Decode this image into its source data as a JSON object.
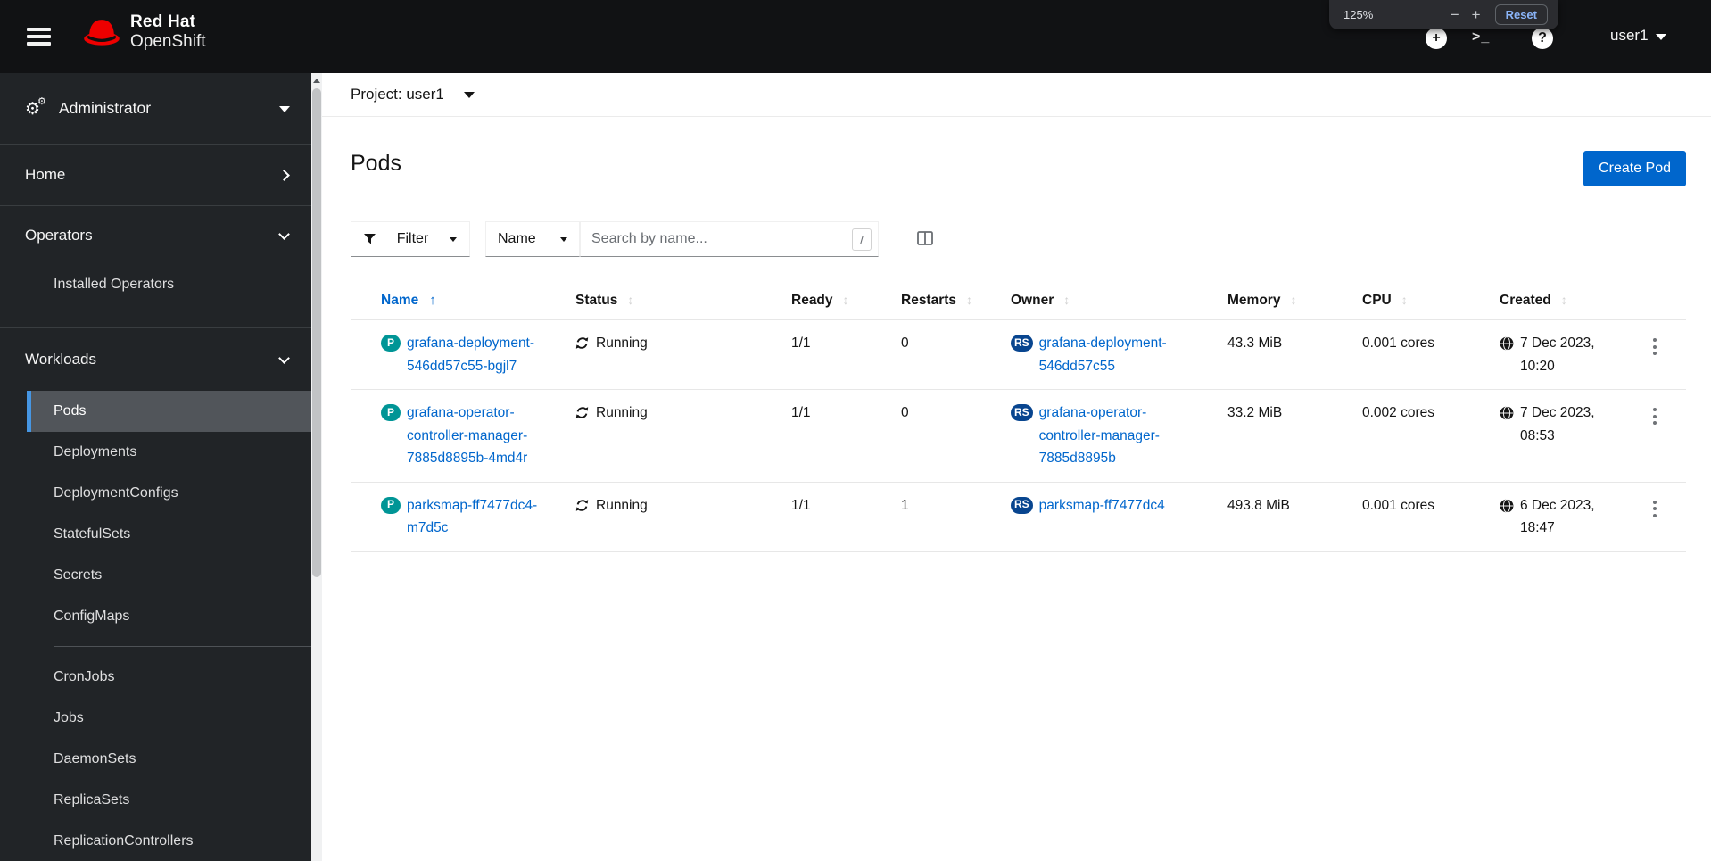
{
  "masthead": {
    "brand": {
      "line1": "Red Hat",
      "line2": "OpenShift"
    },
    "user_label": "user1",
    "plus_icon_glyph": "+",
    "help_icon_glyph": "?"
  },
  "browser_zoom_popup": {
    "zoom_level": "125%",
    "zoom_out_label": "−",
    "zoom_in_label": "+",
    "reset_label": "Reset"
  },
  "sidebar": {
    "perspective_label": "Administrator",
    "home_label": "Home",
    "operators_label": "Operators",
    "operators_items": [
      "Installed Operators"
    ],
    "workloads_label": "Workloads",
    "workloads_items": [
      "Pods",
      "Deployments",
      "DeploymentConfigs",
      "StatefulSets",
      "Secrets",
      "ConfigMaps",
      "CronJobs",
      "Jobs",
      "DaemonSets",
      "ReplicaSets",
      "ReplicationControllers"
    ],
    "active_item": "Pods"
  },
  "project_bar": {
    "selector_label": "Project: user1"
  },
  "page_header": {
    "title": "Pods",
    "create_button_label": "Create Pod"
  },
  "toolbar": {
    "filter_button_label": "Filter",
    "attribute_select_label": "Name",
    "search_placeholder": "Search by name...",
    "search_shortcut_hint": "/"
  },
  "table": {
    "columns": [
      "Name",
      "Status",
      "Ready",
      "Restarts",
      "Owner",
      "Memory",
      "CPU",
      "Created"
    ],
    "sorted_column": "Name",
    "sort_direction": "ascending",
    "rows": [
      {
        "kind_badge": "P",
        "name": "grafana-deployment-546dd57c55-bgjl7",
        "status": "Running",
        "ready": "1/1",
        "restarts": "0",
        "owner_kind_badge": "RS",
        "owner": "grafana-deployment-546dd57c55",
        "memory": "43.3 MiB",
        "cpu": "0.001 cores",
        "created": "7 Dec 2023, 10:20"
      },
      {
        "kind_badge": "P",
        "name": "grafana-operator-controller-manager-7885d8895b-4md4r",
        "status": "Running",
        "ready": "1/1",
        "restarts": "0",
        "owner_kind_badge": "RS",
        "owner": "grafana-operator-controller-manager-7885d8895b",
        "memory": "33.2 MiB",
        "cpu": "0.002 cores",
        "created": "7 Dec 2023, 08:53"
      },
      {
        "kind_badge": "P",
        "name": "parksmap-ff7477dc4-m7d5c",
        "status": "Running",
        "ready": "1/1",
        "restarts": "1",
        "owner_kind_badge": "RS",
        "owner": "parksmap-ff7477dc4",
        "memory": "493.8 MiB",
        "cpu": "0.001 cores",
        "created": "6 Dec 2023, 18:47"
      }
    ]
  },
  "colors": {
    "accent_blue": "#0066cc",
    "brand_red": "#ee0000",
    "pod_badge_teal": "#009596",
    "replicaset_badge_blue": "#08458f",
    "active_nav_indicator": "#4696e3",
    "masthead_bg": "#111214",
    "sidebar_bg": "#212427",
    "zoom_reset_blue": "#8ab4f8"
  }
}
